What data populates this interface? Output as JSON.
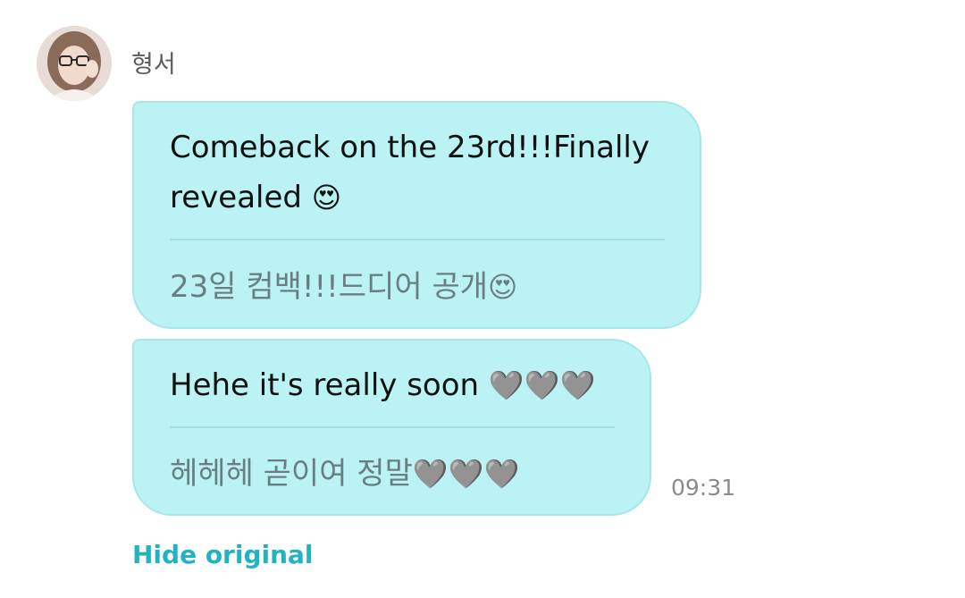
{
  "sender": {
    "name": "형서",
    "avatar_icon": "profile-photo"
  },
  "messages": [
    {
      "translated": "Comeback on the 23rd!!!Finally\nrevealed",
      "translated_emoji": "😍",
      "original": "23일 컴백!!!드디어 공개",
      "original_emoji": "😍"
    },
    {
      "translated": "Hehe it's really soon",
      "translated_emoji": "🩶🩶🩶",
      "original": "헤헤헤 곧이여 정말",
      "original_emoji": "🩶🩶🩶"
    }
  ],
  "timestamp": "09:31",
  "hide_original_label": "Hide original",
  "colors": {
    "bubble": "#bbf2f4",
    "bubble_border": "#a7e6ea",
    "link": "#22b3c0",
    "original_text": "#6a7e81"
  }
}
